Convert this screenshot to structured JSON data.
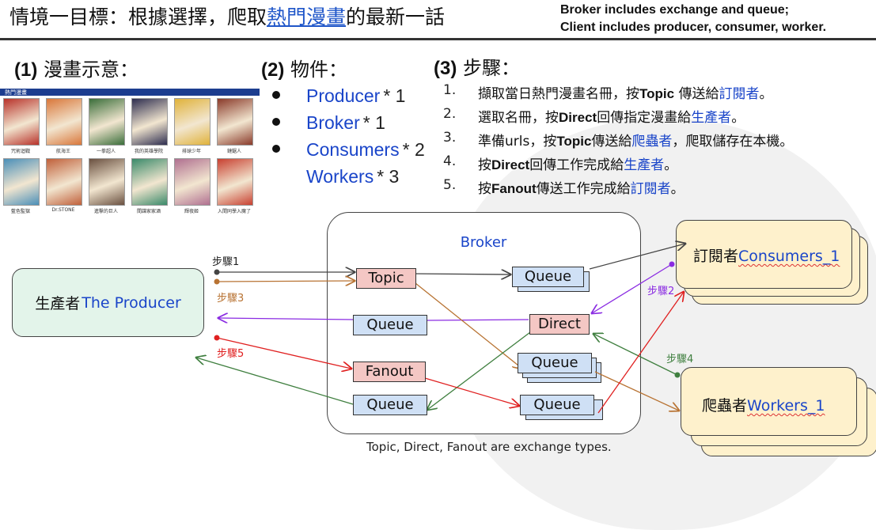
{
  "header": {
    "title_prefix": "情境一目標：根據選擇，爬取",
    "title_highlight": "熱門漫畫",
    "title_suffix": "的最新一話",
    "note_line1": "Broker includes exchange and queue;",
    "note_line2": "Client includes producer, consumer, worker."
  },
  "section1": {
    "num": "(1)",
    "title": "漫畫示意：",
    "site_label": "熱門漫畫",
    "thumbnails": [
      {
        "color": "#b8322a",
        "caption": "咒術迴戰"
      },
      {
        "color": "#d9773a",
        "caption": "航海王"
      },
      {
        "color": "#3a6e3a",
        "caption": "一拳超人"
      },
      {
        "color": "#2d2d4f",
        "caption": "我的英雄學院"
      },
      {
        "color": "#e0b23a",
        "caption": "排球少年"
      },
      {
        "color": "#8a3a2a",
        "caption": "鏈鋸人"
      },
      {
        "color": "#4a8fb8",
        "caption": "藍色監獄"
      },
      {
        "color": "#c0603a",
        "caption": "Dr.STONE"
      },
      {
        "color": "#6a5040",
        "caption": "進擊的巨人"
      },
      {
        "color": "#3a8a6a",
        "caption": "間諜家家酒"
      },
      {
        "color": "#b07090",
        "caption": "輝夜姬"
      },
      {
        "color": "#c84030",
        "caption": "入間同學入魔了"
      }
    ]
  },
  "section2": {
    "num": "(2)",
    "title": "物件：",
    "items": [
      {
        "name": "Producer",
        "count": "* 1",
        "bullet": true
      },
      {
        "name": "Broker",
        "count": "* 1",
        "bullet": true
      },
      {
        "name": "Consumers",
        "count": "* 2",
        "bullet": true
      },
      {
        "name": "Workers",
        "count": "* 3",
        "bullet": false
      }
    ]
  },
  "section3": {
    "num": "(3)",
    "title": "步驟：",
    "steps": [
      {
        "num": "1.",
        "parts": [
          {
            "t": "擷取當日熱門漫畫名冊，按"
          },
          {
            "t": "Topic",
            "b": true
          },
          {
            "t": " 傳送給"
          },
          {
            "t": "訂閱者",
            "c": "blue"
          },
          {
            "t": "。"
          }
        ]
      },
      {
        "num": "2.",
        "parts": [
          {
            "t": "選取名冊，按"
          },
          {
            "t": "Direct",
            "b": true
          },
          {
            "t": "回傳指定漫畫給"
          },
          {
            "t": "生產者",
            "c": "blue"
          },
          {
            "t": "。"
          }
        ]
      },
      {
        "num": "3.",
        "parts": [
          {
            "t": "準備urls，按"
          },
          {
            "t": "Topic",
            "b": true
          },
          {
            "t": "傳送給"
          },
          {
            "t": "爬蟲者",
            "c": "blue"
          },
          {
            "t": "，爬取儲存在本機。"
          }
        ]
      },
      {
        "num": "4.",
        "parts": [
          {
            "t": "按"
          },
          {
            "t": "Direct",
            "b": true
          },
          {
            "t": "回傳工作完成給"
          },
          {
            "t": "生產者",
            "c": "blue"
          },
          {
            "t": "。"
          }
        ]
      },
      {
        "num": "5.",
        "parts": [
          {
            "t": "按"
          },
          {
            "t": "Fanout",
            "b": true
          },
          {
            "t": "傳送工作完成給"
          },
          {
            "t": "訂閱者",
            "c": "blue"
          },
          {
            "t": "。"
          }
        ]
      }
    ]
  },
  "diagram": {
    "broker_label": "Broker",
    "producer_prefix": "生產者",
    "producer_name": "The Producer",
    "consumer_prefix": "訂閱者",
    "consumer_name": "Consumers_1",
    "worker_prefix": "爬蟲者",
    "worker_name": "Workers_1",
    "exchange_topic": "Topic",
    "exchange_direct": "Direct",
    "exchange_fanout": "Fanout",
    "queue_label": "Queue",
    "step1": "步驟1",
    "step2": "步驟2",
    "step3": "步驟3",
    "step4": "步驟4",
    "step5": "步驟5",
    "caption": "Topic, Direct, Fanout are exchange types."
  },
  "colors": {
    "accent_blue": "#1a45c9",
    "queue_fill": "#cfe0f5",
    "exchange_fill": "#f4c7c4",
    "producer_fill": "#e3f4ea",
    "client_fill": "#fef1cc",
    "step1_line": "#444444",
    "step2_line": "#8a2be2",
    "step3_line": "#b87333",
    "step4_line": "#3f7f3f",
    "step5_line": "#e02020"
  }
}
